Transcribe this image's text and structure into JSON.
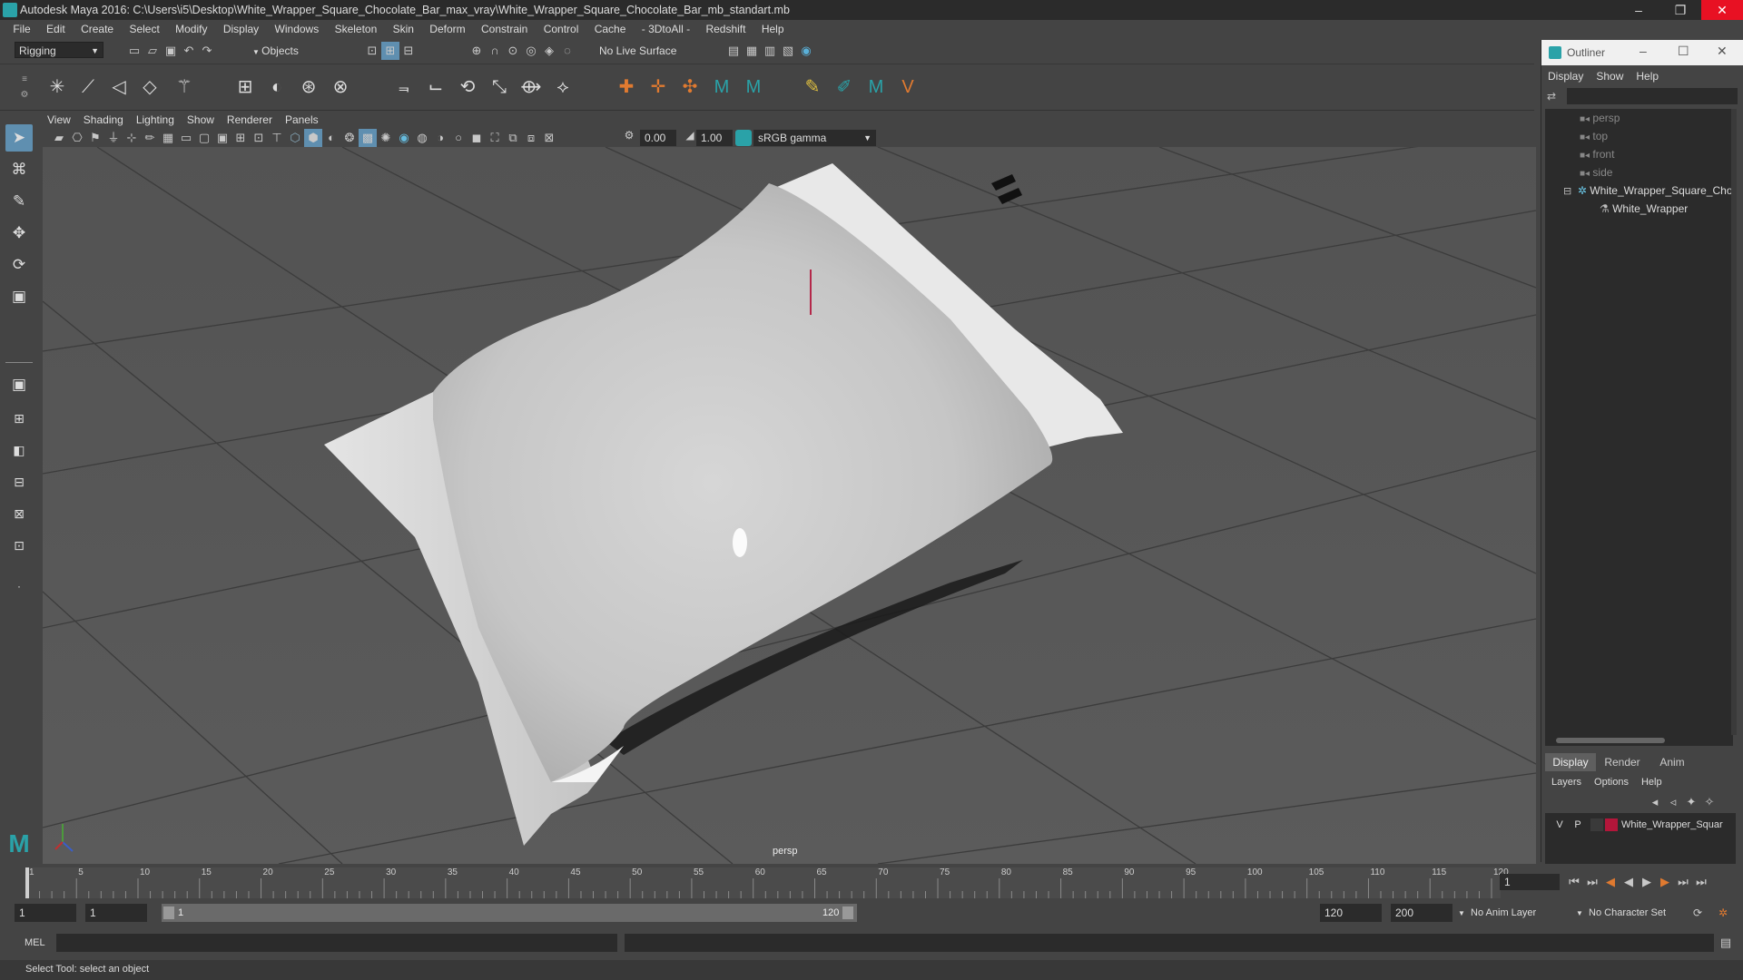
{
  "window": {
    "title": "Autodesk Maya 2016: C:\\Users\\i5\\Desktop\\White_Wrapper_Square_Chocolate_Bar_max_vray\\White_Wrapper_Square_Chocolate_Bar_mb_standart.mb",
    "minimize": "–",
    "maximize": "❐",
    "close": "✕"
  },
  "menubar": [
    "File",
    "Edit",
    "Create",
    "Select",
    "Modify",
    "Display",
    "Windows",
    "Skeleton",
    "Skin",
    "Deform",
    "Constrain",
    "Control",
    "Cache",
    "- 3DtoAll -",
    "Redshift",
    "Help"
  ],
  "statusline": {
    "menuset": "Rigging",
    "selection_mode": "Objects",
    "live_surface": "No Live Surface"
  },
  "viewport": {
    "menus": [
      "View",
      "Shading",
      "Lighting",
      "Show",
      "Renderer",
      "Panels"
    ],
    "exposure": "0.00",
    "gamma": "1.00",
    "colorspace": "sRGB gamma",
    "camera_label": "persp"
  },
  "outliner": {
    "title": "Outliner",
    "menus": [
      "Display",
      "Show",
      "Help"
    ],
    "items": [
      {
        "label": "persp",
        "icon": "camera-icon"
      },
      {
        "label": "top",
        "icon": "camera-icon"
      },
      {
        "label": "front",
        "icon": "camera-icon"
      },
      {
        "label": "side",
        "icon": "camera-icon"
      },
      {
        "label": "White_Wrapper_Square_Cho",
        "icon": "group-icon"
      },
      {
        "label": "White_Wrapper",
        "icon": "mesh-icon"
      }
    ]
  },
  "layer_editor": {
    "tabs": [
      "Display",
      "Render",
      "Anim"
    ],
    "menus": [
      "Layers",
      "Options",
      "Help"
    ],
    "layer": {
      "v": "V",
      "p": "P",
      "name": "White_Wrapper_Squar",
      "color": "#b3163a"
    }
  },
  "timeline": {
    "ticks": [
      "1",
      "5",
      "10",
      "15",
      "20",
      "25",
      "30",
      "35",
      "40",
      "45",
      "50",
      "55",
      "60",
      "65",
      "70",
      "75",
      "80",
      "85",
      "90",
      "95",
      "100",
      "105",
      "110",
      "115",
      "120"
    ],
    "current_frame": "1"
  },
  "range": {
    "start": "1",
    "playback_start": "1",
    "slider_start": "1",
    "slider_end": "120",
    "playback_end": "120",
    "end": "200",
    "anim_layer": "No Anim Layer",
    "character_set": "No Character Set"
  },
  "command_line": {
    "label": "MEL"
  },
  "help_line": {
    "text": "Select Tool: select an object"
  }
}
